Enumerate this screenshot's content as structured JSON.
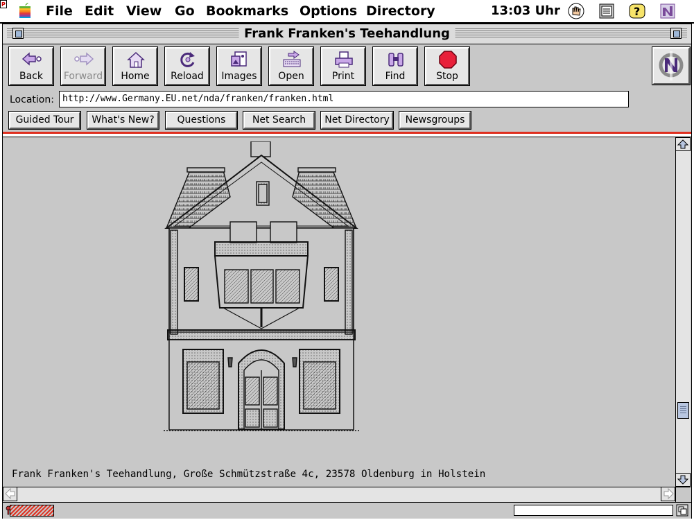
{
  "menubar": {
    "items": [
      "File",
      "Edit",
      "View",
      "Go",
      "Bookmarks",
      "Options",
      "Directory"
    ],
    "clock": "13:03 Uhr"
  },
  "window": {
    "title": "Frank Franken's Teehandlung"
  },
  "toolbar": {
    "back": "Back",
    "forward": "Forward",
    "home": "Home",
    "reload": "Reload",
    "images": "Images",
    "open": "Open",
    "print": "Print",
    "find": "Find",
    "stop": "Stop"
  },
  "location": {
    "label": "Location:",
    "url": "http://www.Germany.EU.net/nda/franken/franken.html"
  },
  "directory_buttons": [
    "Guided Tour",
    "What's New?",
    "Questions",
    "Net Search",
    "Net Directory",
    "Newsgroups"
  ],
  "content": {
    "caption": "Frank Franken's Teehandlung, Große Schmützstraße 4c, 23578 Oldenburg in Holstein"
  },
  "colors": {
    "accent_line": "#e03020",
    "background": "#c8c8c8"
  }
}
